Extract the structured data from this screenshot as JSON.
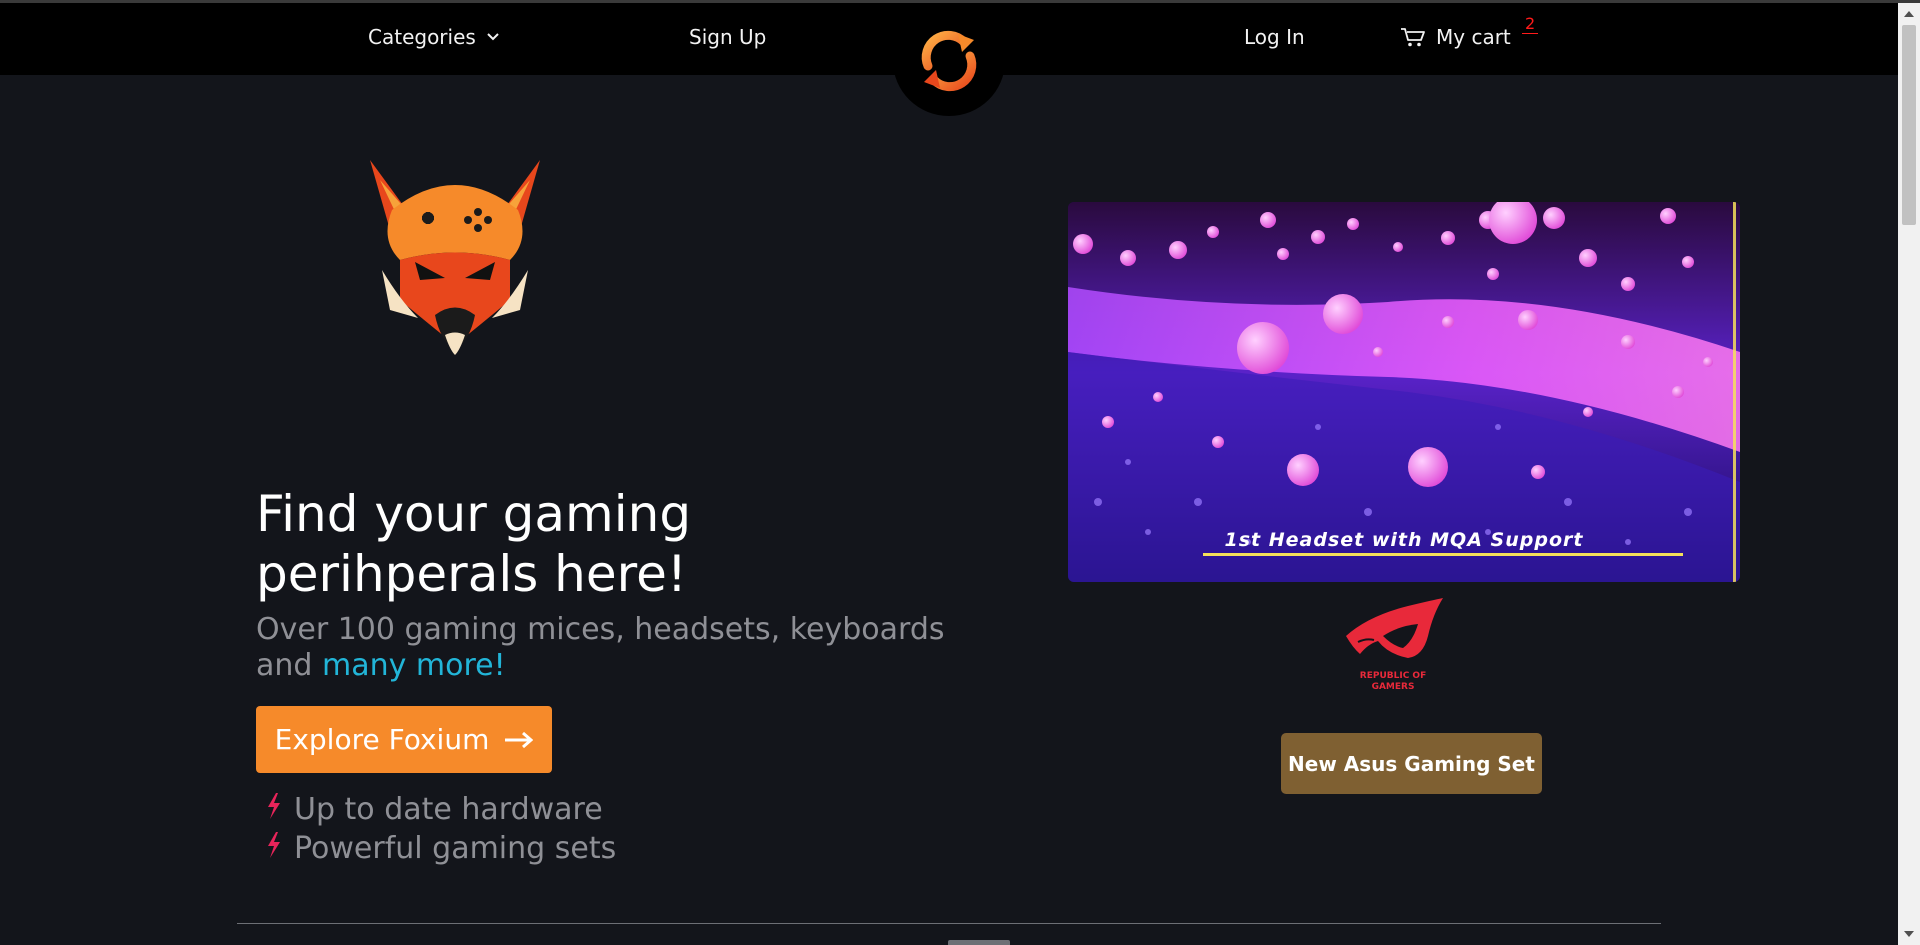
{
  "nav": {
    "categories_label": "Categories",
    "signup_label": "Sign Up",
    "login_label": "Log In",
    "cart_label": "My cart",
    "cart_count": "2"
  },
  "hero": {
    "title_line1": "Find your gaming",
    "title_line2": "perihperals here!",
    "subtitle_line1": "Over 100 gaming mices, headsets, keyboards",
    "subtitle_and": "and ",
    "subtitle_accent": "many more!",
    "cta_label": "Explore Foxium",
    "features": [
      "Up to date hardware",
      "Powerful gaming sets"
    ]
  },
  "promo": {
    "video_caption": "1st Headset with MQA Support",
    "brand_text_line1": "REPUBLIC OF",
    "brand_text_line2": "GAMERS",
    "button_label": "New Asus Gaming Set"
  },
  "colors": {
    "background": "#13151b",
    "navbar": "#000000",
    "accent_orange": "#f68a2a",
    "accent_cyan": "#22b5d8",
    "feature_bolt": "#e8245a",
    "asus_button": "#7f6032",
    "cart_badge": "#ff1a1a"
  },
  "icons": {
    "categories_chevron": "chevron-down-icon",
    "cart": "cart-icon",
    "site_logo": "refresh-logo-icon",
    "cta_arrow": "arrow-right-icon",
    "feature_bullet": "lightning-icon"
  }
}
